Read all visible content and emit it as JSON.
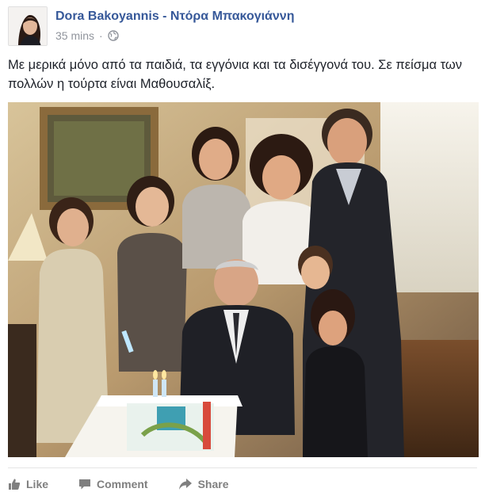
{
  "post": {
    "author": "Dora Bakoyannis - Ντόρα Μπακογιάννη",
    "timestamp": "35 mins",
    "separator": "·",
    "privacy_icon": "globe-icon",
    "text": "Με μερικά μόνο από τα παιδιά, τα εγγόνια και τα δισέγγονά του. Σε πείσμα των πολλών η τούρτα είναι Μαθουσαλίξ."
  },
  "actions": {
    "like_label": "Like",
    "comment_label": "Comment",
    "share_label": "Share"
  },
  "colors": {
    "author_link": "#365899",
    "meta_text": "#90949c",
    "action_text": "#7f7f7f"
  }
}
